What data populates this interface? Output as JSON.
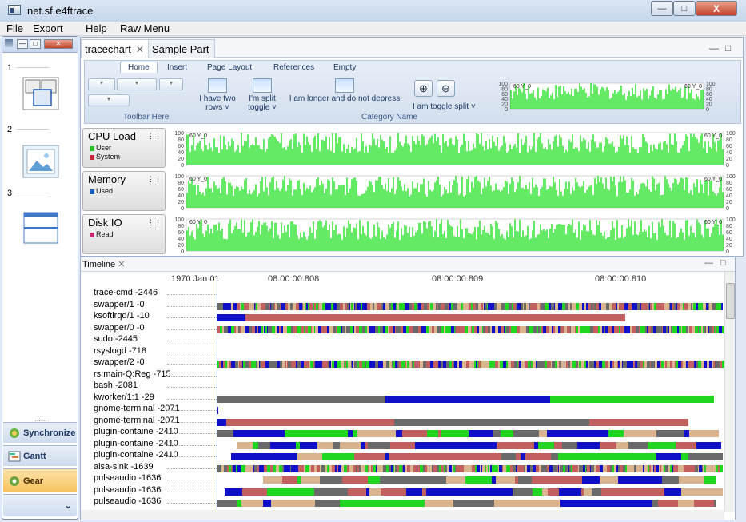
{
  "window": {
    "title": "net.sf.e4ftrace",
    "buttons": {
      "minimize": "—",
      "maximize": "□",
      "close": "X"
    }
  },
  "menu": [
    "File",
    "Export",
    "Help",
    "Raw Menu"
  ],
  "left_panel": {
    "numbers": [
      "1",
      "2",
      "3"
    ],
    "buttons": [
      "Synchronize",
      "Gantt",
      "Gear"
    ],
    "active": "Gear",
    "more": "⌄"
  },
  "editor_tabs": [
    {
      "label": "tracechart",
      "close": "✕"
    },
    {
      "label": "Sample Part"
    }
  ],
  "ribbon": {
    "tabs": [
      "Home",
      "Insert",
      "Page Layout",
      "References",
      "Empty"
    ],
    "group1_label": "Toolbar Here",
    "group2_label": "Category Name",
    "big_buttons": [
      "I have two rows ˅",
      "I'm split toggle ˅",
      "I am longer and do not depress"
    ],
    "toggle_split": "I am toggle split ˅",
    "zoom_in": "⊕",
    "zoom_out": "⊖"
  },
  "cpu": {
    "name": "CPU Load",
    "legend": [
      {
        "label": "User",
        "color": "#2bbf2b"
      },
      {
        "label": "System",
        "color": "#c8283c"
      }
    ]
  },
  "memory": {
    "name": "Memory",
    "legend": [
      {
        "label": "Used",
        "color": "#1f5fbf"
      }
    ]
  },
  "disk": {
    "name": "Disk IO",
    "legend": [
      {
        "label": "Read",
        "color": "#c8286e"
      }
    ]
  },
  "plot_labels": {
    "series_label": "60 Y_0",
    "ticks": [
      "100",
      "80",
      "60",
      "40",
      "20",
      "0"
    ],
    "grip": "⋮⋮"
  },
  "timeline": {
    "tab": "Timeline",
    "close": "✕",
    "axis": [
      "1970 Jan 01",
      "08:00:00.808",
      "08:00:00.809",
      "08:00:00.810"
    ],
    "rows": [
      "trace-cmd -2446",
      "swapper/1 -0",
      "ksoftirqd/1 -10",
      "swapper/0 -0",
      "sudo -2445",
      "rsyslogd -718",
      "swapper/2 -0",
      "rs:main-Q:Reg -715",
      "bash -2081",
      "kworker/1:1 -29",
      "gnome-terminal -2071",
      "gnome-terminal -2071",
      "plugin-containe -2410",
      "plugin-containe -2410",
      "plugin-containe -2410",
      "alsa-sink -1639",
      "pulseaudio -1636",
      "pulseaudio -1636",
      "pulseaudio -1636"
    ]
  },
  "colors": {
    "green": "#20d620",
    "blue": "#1010c8",
    "red": "#c26060",
    "gray": "#6a6a6a"
  }
}
